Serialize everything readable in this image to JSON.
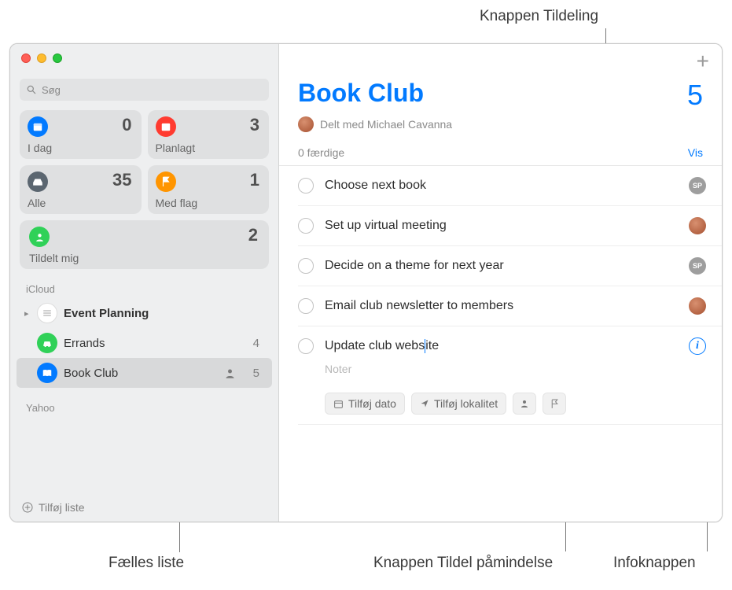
{
  "callouts": {
    "top": "Knappen Tildeling",
    "bottom_left": "Fælles liste",
    "bottom_mid": "Knappen Tildel påmindelse",
    "bottom_right": "Infoknappen"
  },
  "search": {
    "placeholder": "Søg"
  },
  "smart": {
    "today": {
      "label": "I dag",
      "count": "0"
    },
    "scheduled": {
      "label": "Planlagt",
      "count": "3"
    },
    "all": {
      "label": "Alle",
      "count": "35"
    },
    "flagged": {
      "label": "Med flag",
      "count": "1"
    },
    "assigned": {
      "label": "Tildelt mig",
      "count": "2"
    }
  },
  "accounts": {
    "icloud": "iCloud",
    "yahoo": "Yahoo"
  },
  "lists": {
    "event": {
      "name": "Event Planning",
      "count": ""
    },
    "errands": {
      "name": "Errands",
      "count": "4"
    },
    "book": {
      "name": "Book Club",
      "count": "5"
    }
  },
  "footer": {
    "add_list": "Tilføj liste"
  },
  "main": {
    "title": "Book Club",
    "count": "5",
    "shared_with": "Delt med Michael Cavanna",
    "done": "0 færdige",
    "show": "Vis"
  },
  "reminders": [
    {
      "title": "Choose next book",
      "assignee": "sp"
    },
    {
      "title": "Set up virtual meeting",
      "assignee": "photo"
    },
    {
      "title": "Decide on a theme for next year",
      "assignee": "sp"
    },
    {
      "title": "Email club newsletter to members",
      "assignee": "photo"
    }
  ],
  "editing": {
    "title_a": "Update club webs",
    "title_b": "ite",
    "notes_placeholder": "Noter",
    "chip_date": "Tilføj dato",
    "chip_loc": "Tilføj lokalitet"
  },
  "assignee_initials": {
    "sp": "SP"
  }
}
